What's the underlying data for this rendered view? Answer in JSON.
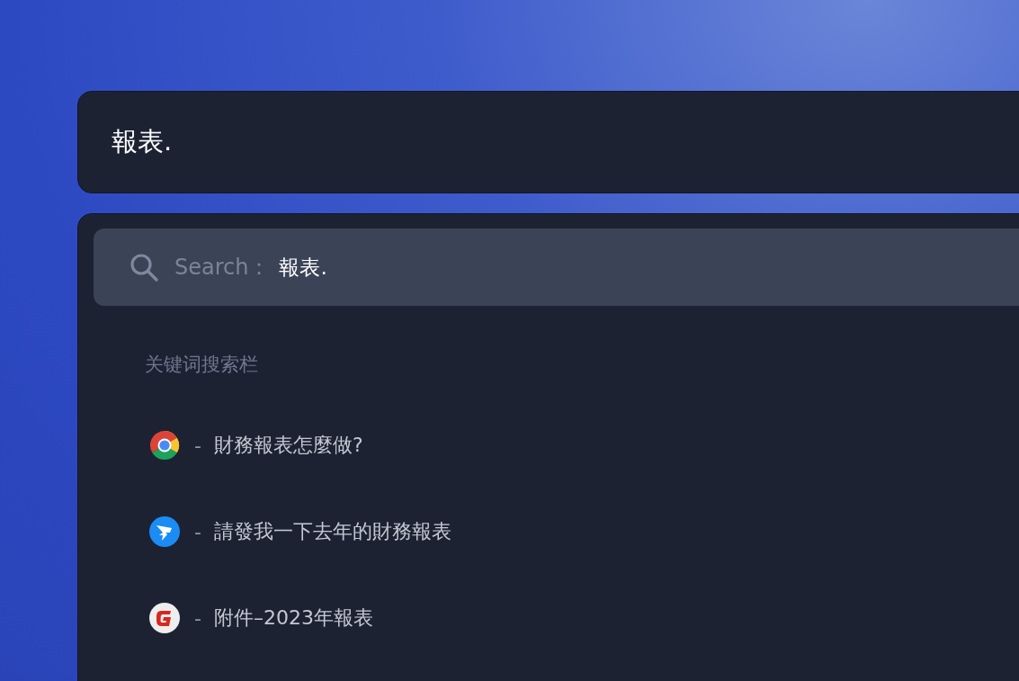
{
  "query_bar": {
    "value": "報表."
  },
  "search": {
    "label": "Search：",
    "value": "報表."
  },
  "section_title": "关键词搜索栏",
  "results": [
    {
      "kind": "chrome",
      "dash": "-",
      "text": "財務報表怎麼做?"
    },
    {
      "kind": "bird",
      "dash": "-",
      "text": "請發我一下去年的財務報表"
    },
    {
      "kind": "g-logo",
      "dash": "-",
      "text": "附件–2023年報表"
    }
  ]
}
